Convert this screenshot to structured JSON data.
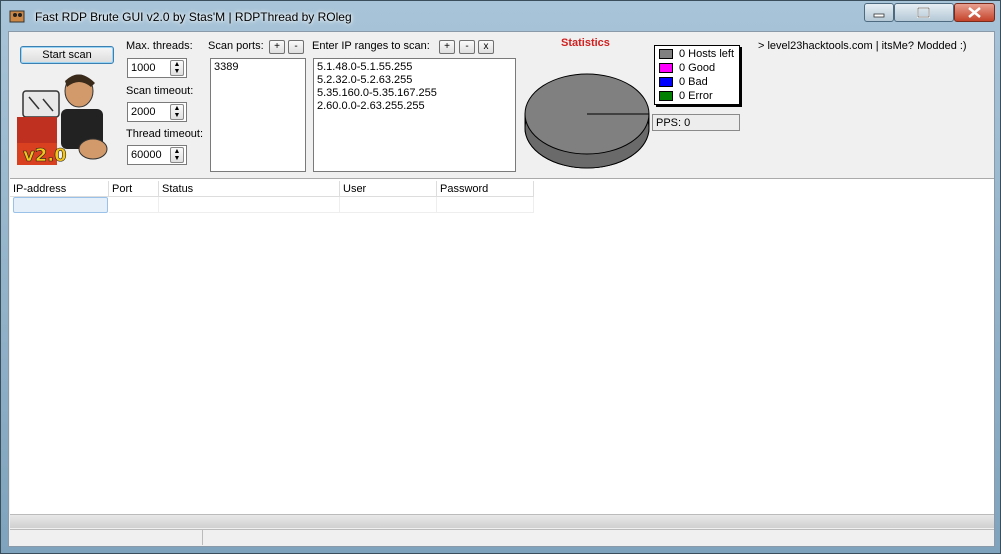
{
  "window": {
    "title": "Fast RDP Brute GUI v2.0 by Stas'M | RDPThread by ROleg"
  },
  "controls": {
    "start_scan_label": "Start scan",
    "max_threads_label": "Max. threads:",
    "max_threads_value": "1000",
    "scan_timeout_label": "Scan timeout:",
    "scan_timeout_value": "2000",
    "thread_timeout_label": "Thread timeout:",
    "thread_timeout_value": "60000",
    "logo_text": "v2.0"
  },
  "ports": {
    "label": "Scan ports:",
    "add": "+",
    "remove": "-",
    "items": [
      "3389"
    ]
  },
  "ranges": {
    "label": "Enter IP ranges to scan:",
    "add": "+",
    "remove": "-",
    "clear": "x",
    "items": [
      "5.1.48.0-5.1.55.255",
      "5.2.32.0-5.2.63.255",
      "5.35.160.0-5.35.167.255",
      "2.60.0.0-2.63.255.255"
    ]
  },
  "statistics": {
    "title": "Statistics",
    "legend": [
      {
        "label": "0 Hosts left",
        "color": "#808080"
      },
      {
        "label": "0 Good",
        "color": "#ff00ff"
      },
      {
        "label": "0 Bad",
        "color": "#0000ff"
      },
      {
        "label": "0 Error",
        "color": "#008000"
      }
    ],
    "pps": "PPS: 0"
  },
  "credit": "> level23hacktools.com | itsMe? Modded :)",
  "table": {
    "columns": [
      "IP-address",
      "Port",
      "Status",
      "User",
      "Password"
    ]
  }
}
